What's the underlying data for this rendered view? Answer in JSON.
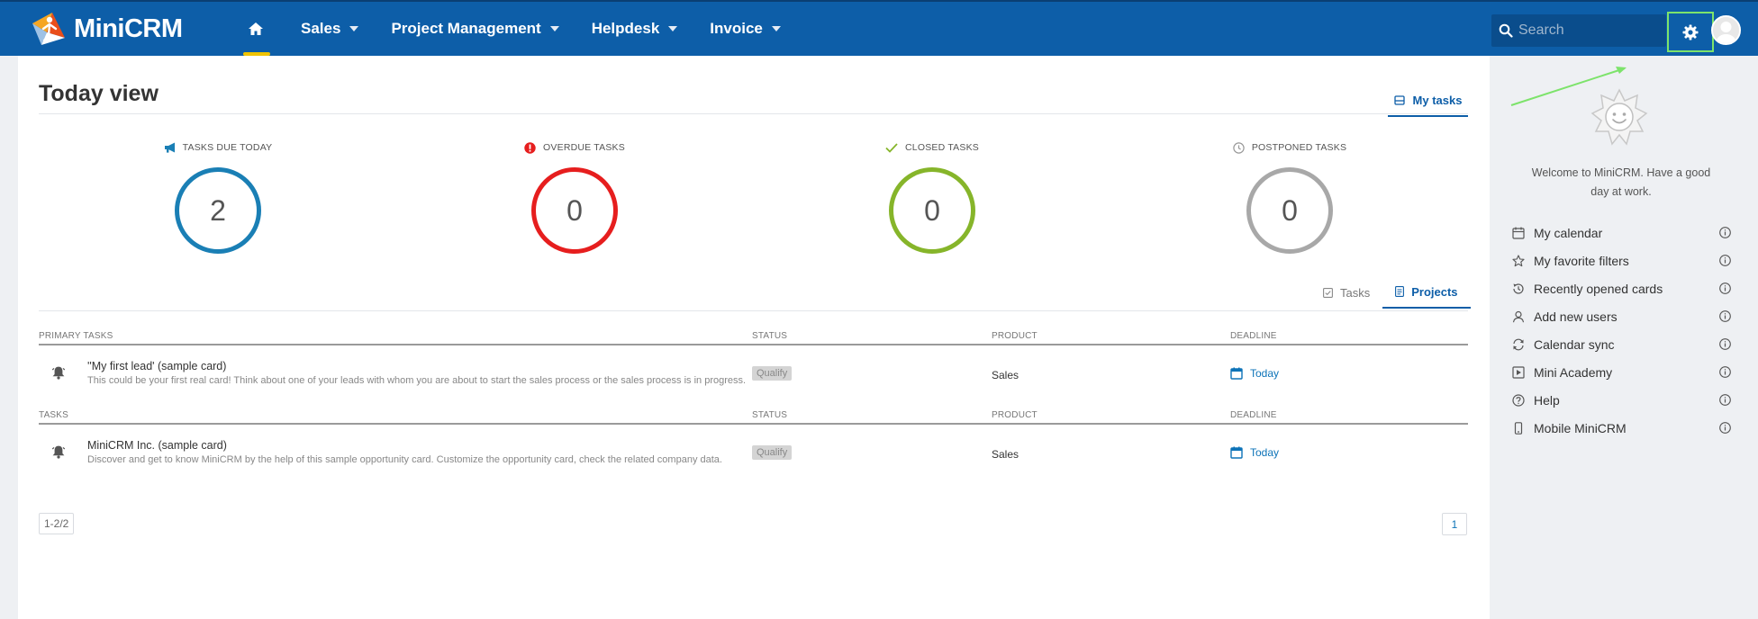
{
  "app": {
    "name": "MiniCRM"
  },
  "nav": {
    "items": [
      {
        "label": "Sales"
      },
      {
        "label": "Project Management"
      },
      {
        "label": "Helpdesk"
      },
      {
        "label": "Invoice"
      }
    ]
  },
  "search": {
    "placeholder": "Search"
  },
  "page": {
    "title": "Today view",
    "my_tasks_tab": "My tasks"
  },
  "stats": [
    {
      "label": "TASKS DUE TODAY",
      "value": "2",
      "color": "#1a7fb5",
      "icon": "megaphone-icon"
    },
    {
      "label": "OVERDUE TASKS",
      "value": "0",
      "color": "#e61e1e",
      "icon": "alert-icon"
    },
    {
      "label": "CLOSED TASKS",
      "value": "0",
      "color": "#86b52a",
      "icon": "check-icon"
    },
    {
      "label": "POSTPONED TASKS",
      "value": "0",
      "color": "#a8a8a8",
      "icon": "clock-icon"
    }
  ],
  "sub_tabs": {
    "tasks": "Tasks",
    "projects": "Projects"
  },
  "primary_table": {
    "headers": {
      "name": "PRIMARY TASKS",
      "status": "STATUS",
      "product": "PRODUCT",
      "deadline": "DEADLINE"
    },
    "rows": [
      {
        "title": "''My first lead' (sample card)",
        "desc": "This could be your first real card! Think about one of your leads with whom you are about to start the sales process or the sales process is in progress.",
        "status": "Qualify",
        "product": "Sales",
        "deadline": "Today"
      }
    ]
  },
  "tasks_table": {
    "headers": {
      "name": "TASKS",
      "status": "STATUS",
      "product": "PRODUCT",
      "deadline": "DEADLINE"
    },
    "rows": [
      {
        "title": "MiniCRM Inc. (sample card)",
        "desc": "Discover and get to know MiniCRM by the help of this sample opportunity card. Customize the opportunity card, check the related company data.",
        "status": "Qualify",
        "product": "Sales",
        "deadline": "Today"
      }
    ]
  },
  "pager": {
    "range": "1-2/2",
    "page": "1"
  },
  "sidebar": {
    "welcome": "Welcome to MiniCRM. Have a good day at work.",
    "items": [
      {
        "label": "My calendar",
        "icon": "calendar-icon"
      },
      {
        "label": "My favorite filters",
        "icon": "star-icon"
      },
      {
        "label": "Recently opened cards",
        "icon": "history-icon"
      },
      {
        "label": "Add new users",
        "icon": "user-icon"
      },
      {
        "label": "Calendar sync",
        "icon": "sync-icon"
      },
      {
        "label": "Mini Academy",
        "icon": "play-icon"
      },
      {
        "label": "Help",
        "icon": "help-icon"
      },
      {
        "label": "Mobile MiniCRM",
        "icon": "mobile-icon"
      }
    ]
  },
  "colors": {
    "brand": "#0d5ea8",
    "accent": "#f0c300",
    "highlight": "#7de36b"
  }
}
